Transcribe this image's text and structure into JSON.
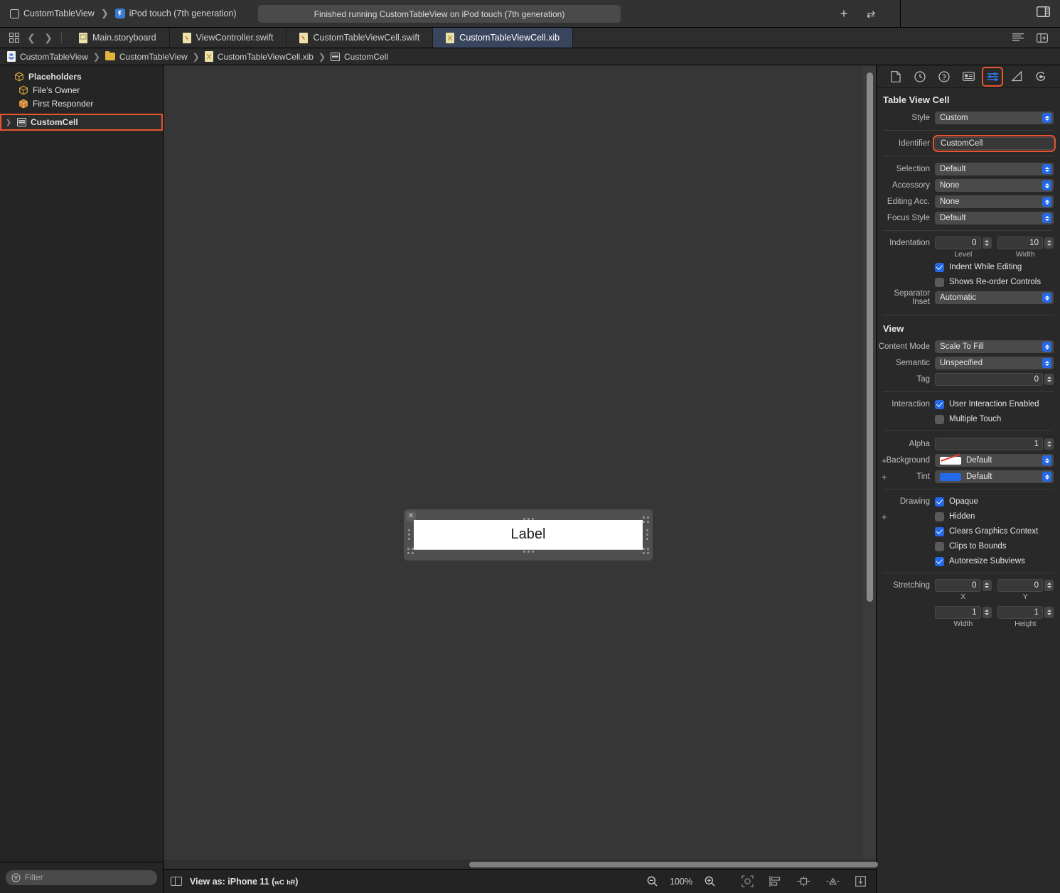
{
  "toolbar": {
    "scheme": "CustomTableView",
    "destination": "iPod touch (7th generation)",
    "status": "Finished running CustomTableView on iPod touch (7th generation)",
    "add_label": "+",
    "swap_label": "⇄"
  },
  "tabs": [
    {
      "label": "Main.storyboard",
      "icon": "storyboard-file-icon",
      "active": false
    },
    {
      "label": "ViewController.swift",
      "icon": "swift-file-icon",
      "active": false
    },
    {
      "label": "CustomTableViewCell.swift",
      "icon": "swift-file-icon",
      "active": false
    },
    {
      "label": "CustomTableViewCell.xib",
      "icon": "xib-file-icon",
      "active": true
    }
  ],
  "breadcrumb": [
    {
      "label": "CustomTableView",
      "icon": "project-icon"
    },
    {
      "label": "CustomTableView",
      "icon": "folder-icon"
    },
    {
      "label": "CustomTableViewCell.xib",
      "icon": "xib-file-icon"
    },
    {
      "label": "CustomCell",
      "icon": "table-cell-icon"
    }
  ],
  "navigator": {
    "items": [
      {
        "label": "Placeholders",
        "icon": "cube-icon",
        "level": 0,
        "selected": false
      },
      {
        "label": "File's Owner",
        "icon": "cube-icon",
        "level": 1,
        "selected": false
      },
      {
        "label": "First Responder",
        "icon": "cube-icon",
        "level": 1,
        "selected": false
      },
      {
        "label": "CustomCell",
        "icon": "table-cell-icon",
        "level": 0,
        "selected": true
      }
    ],
    "filter_placeholder": "Filter"
  },
  "canvas": {
    "cell_label": "Label",
    "view_as": "View as: iPhone 11 (",
    "view_as_wc": "wC",
    "view_as_hr": "hR",
    "view_as_close": ")",
    "zoom": "100%",
    "zoom_out_icon": "zoom-out-icon",
    "zoom_in_icon": "zoom-in-icon"
  },
  "inspector": {
    "tabs": [
      {
        "name": "file-inspector-icon",
        "active": false
      },
      {
        "name": "history-inspector-icon",
        "active": false
      },
      {
        "name": "help-inspector-icon",
        "active": false
      },
      {
        "name": "identity-inspector-icon",
        "active": false
      },
      {
        "name": "attributes-inspector-icon",
        "active": true
      },
      {
        "name": "size-inspector-icon",
        "active": false
      },
      {
        "name": "connections-inspector-icon",
        "active": false
      }
    ],
    "section_cell": {
      "title": "Table View Cell",
      "rows": [
        {
          "label": "Style",
          "value": "Custom",
          "type": "popup"
        },
        {
          "label": "Identifier",
          "value": "CustomCell",
          "type": "text",
          "highlighted": true
        },
        {
          "label": "Selection",
          "value": "Default",
          "type": "popup"
        },
        {
          "label": "Accessory",
          "value": "None",
          "type": "popup"
        },
        {
          "label": "Editing Acc.",
          "value": "None",
          "type": "popup"
        },
        {
          "label": "Focus Style",
          "value": "Default",
          "type": "popup"
        }
      ],
      "indentation": {
        "label": "Indentation",
        "level_value": "0",
        "level_caption": "Level",
        "width_value": "10",
        "width_caption": "Width"
      },
      "checkboxes": [
        {
          "label": "Indent While Editing",
          "checked": true
        },
        {
          "label": "Shows Re-order Controls",
          "checked": false
        }
      ],
      "separator_inset": {
        "label": "Separator Inset",
        "value": "Automatic"
      }
    },
    "section_view": {
      "title": "View",
      "content_mode": {
        "label": "Content Mode",
        "value": "Scale To Fill"
      },
      "semantic": {
        "label": "Semantic",
        "value": "Unspecified"
      },
      "tag": {
        "label": "Tag",
        "value": "0"
      },
      "interaction_label": "Interaction",
      "interaction": [
        {
          "label": "User Interaction Enabled",
          "checked": true
        },
        {
          "label": "Multiple Touch",
          "checked": false
        }
      ],
      "alpha": {
        "label": "Alpha",
        "value": "1"
      },
      "background": {
        "label": "Background",
        "value": "Default",
        "swatch": "clear"
      },
      "tint": {
        "label": "Tint",
        "value": "Default",
        "swatch": "#2568e8"
      },
      "drawing_label": "Drawing",
      "drawing": [
        {
          "label": "Opaque",
          "checked": true
        },
        {
          "label": "Hidden",
          "checked": false
        },
        {
          "label": "Clears Graphics Context",
          "checked": true
        },
        {
          "label": "Clips to Bounds",
          "checked": false
        },
        {
          "label": "Autoresize Subviews",
          "checked": true
        }
      ],
      "stretching": {
        "label": "Stretching",
        "x_value": "0",
        "x_caption": "X",
        "y_value": "0",
        "y_caption": "Y",
        "w_value": "1",
        "w_caption": "Width",
        "h_value": "1",
        "h_caption": "Height"
      }
    }
  },
  "colors": {
    "accent_highlight": "#e8552e",
    "control_blue": "#2568e8",
    "active_tab_bg": "#38455c"
  }
}
